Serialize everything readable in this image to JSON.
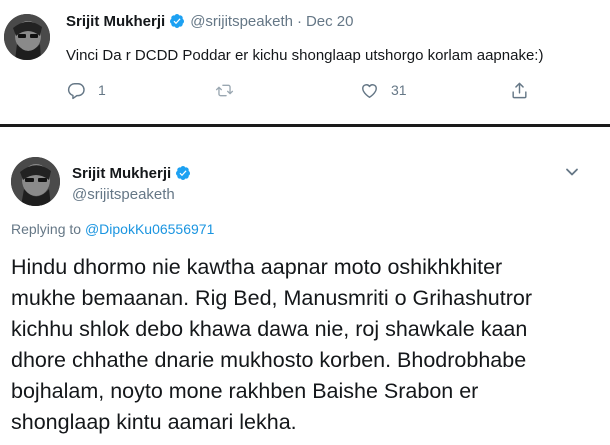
{
  "top_tweet": {
    "author_name": "Srijit Mukherji",
    "author_handle": "@srijitspeaketh",
    "separator": "·",
    "date": "Dec 20",
    "text": "Vinci Da r DCDD Poddar er kichu shonglaap utshorgo korlam aapnake:)",
    "reply_count": "1",
    "like_count": "31"
  },
  "reply_tweet": {
    "author_name": "Srijit Mukherji",
    "author_handle": "@srijitspeaketh",
    "replying_to_label": "Replying to",
    "replying_to_handle": "@DipokKu06556971",
    "text_lines": [
      "Hindu dhormo nie kawtha aapnar moto oshikhkhiter",
      "mukhe bemaanan. Rig Bed, Manusmriti o Grihashutror",
      "kichhu shlok debo khawa dawa nie, roj shawkale kaan",
      "dhore chhathe dnarie mukhosto korben. Bhodrobhabe",
      "bojhalam, noyto mone rakhben Baishe Srabon er",
      "shonglaap kintu aamari lekha."
    ]
  },
  "colors": {
    "accent": "#1da1f2",
    "link": "#1b95e0",
    "secondary_text": "#657786",
    "primary_text": "#14171a"
  },
  "icons": [
    "avatar",
    "verified-badge-icon",
    "reply-icon",
    "retweet-icon",
    "like-icon",
    "share-icon",
    "chevron-down-icon"
  ]
}
